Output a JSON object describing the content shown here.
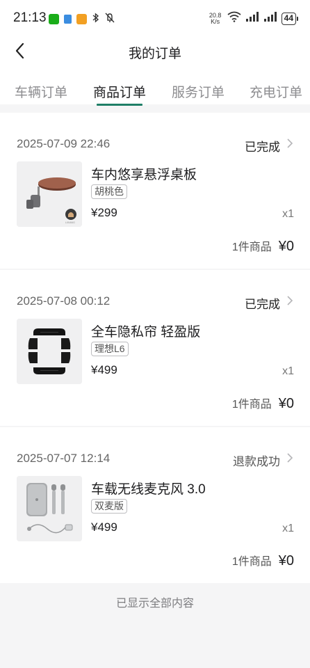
{
  "status_bar": {
    "time": "21:13",
    "net_speed_value": "20.8",
    "net_speed_unit": "K/s",
    "battery": "44",
    "icons": [
      "wechat-icon",
      "app-icon",
      "store-icon",
      "bluetooth-icon",
      "mute-icon",
      "wifi-icon",
      "signal-icon"
    ]
  },
  "header": {
    "title": "我的订单"
  },
  "tabs": [
    {
      "label": "车辆订单",
      "active": false
    },
    {
      "label": "商品订单",
      "active": true
    },
    {
      "label": "服务订单",
      "active": false
    },
    {
      "label": "充电订单",
      "active": false
    }
  ],
  "orders": [
    {
      "date": "2025-07-09 22:46",
      "status": "已完成",
      "product_name": "车内悠享悬浮桌板",
      "variant": "胡桃色",
      "price": "¥299",
      "quantity": "x1",
      "count_text": "1件商品",
      "total": "¥0",
      "thumb_text": "LIXIANG"
    },
    {
      "date": "2025-07-08 00:12",
      "status": "已完成",
      "product_name": "全车隐私帘 轻盈版",
      "variant": "理想L6",
      "price": "¥499",
      "quantity": "x1",
      "count_text": "1件商品",
      "total": "¥0"
    },
    {
      "date": "2025-07-07 12:14",
      "status": "退款成功",
      "product_name": "车载无线麦克风 3.0",
      "variant": "双麦版",
      "price": "¥499",
      "quantity": "x1",
      "count_text": "1件商品",
      "total": "¥0"
    }
  ],
  "footer": {
    "end_text": "已显示全部内容"
  },
  "colors": {
    "accent": "#1f7f67",
    "background": "#f5f5f6",
    "card": "#ffffff"
  }
}
